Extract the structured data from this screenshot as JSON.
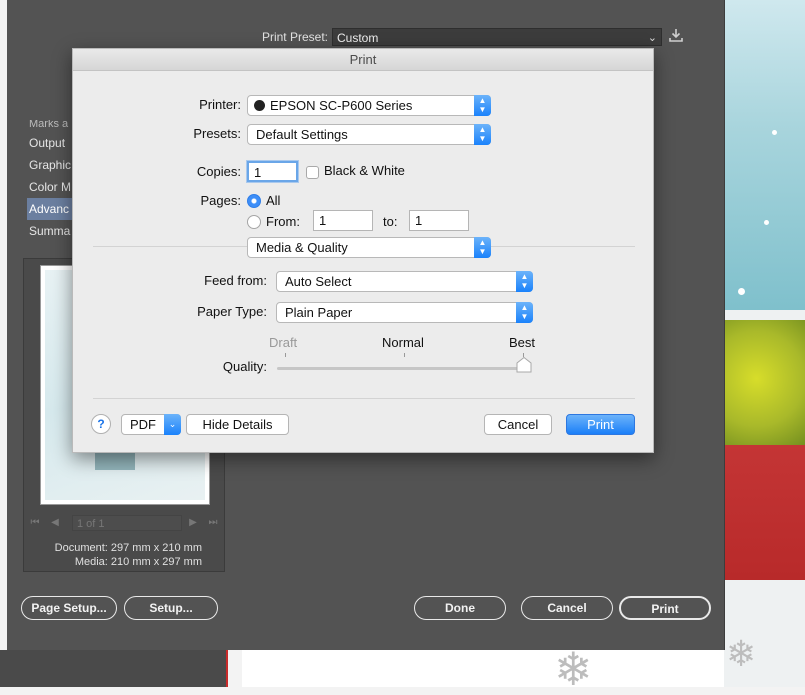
{
  "ai_dialog": {
    "print_preset_label": "Print Preset:",
    "print_preset_value": "Custom",
    "save_preset_icon": "download-icon",
    "categories": [
      {
        "label": "Marks a",
        "state": "partial"
      },
      {
        "label": "Output",
        "state": "normal"
      },
      {
        "label": "Graphic",
        "state": "normal"
      },
      {
        "label": "Color M",
        "state": "normal"
      },
      {
        "label": "Advanc",
        "state": "active"
      },
      {
        "label": "Summa",
        "state": "normal"
      }
    ],
    "page_nav_value": "1 of 1",
    "document_info": "Document: 297 mm x 210 mm",
    "media_info": "Media: 210 mm x 297 mm",
    "buttons": {
      "page_setup": "Page Setup...",
      "setup": "Setup...",
      "done": "Done",
      "cancel": "Cancel",
      "print": "Print"
    }
  },
  "print_sheet": {
    "title": "Print",
    "printer_label": "Printer:",
    "printer_value": "EPSON SC-P600 Series",
    "presets_label": "Presets:",
    "presets_value": "Default Settings",
    "copies_label": "Copies:",
    "copies_value": "1",
    "black_white_label": "Black & White",
    "black_white_checked": false,
    "pages_label": "Pages:",
    "pages_all_label": "All",
    "pages_from_label": "From:",
    "pages_from_value": "1",
    "pages_to_label": "to:",
    "pages_to_value": "1",
    "pages_selected": "All",
    "section_popup": "Media & Quality",
    "feed_from_label": "Feed from:",
    "feed_from_value": "Auto Select",
    "paper_type_label": "Paper Type:",
    "paper_type_value": "Plain Paper",
    "quality_label": "Quality:",
    "quality_draft": "Draft",
    "quality_normal": "Normal",
    "quality_best": "Best",
    "quality_level": "Best",
    "help_label": "?",
    "pdf_label": "PDF",
    "hide_details_label": "Hide Details",
    "cancel_label": "Cancel",
    "print_label": "Print",
    "accent_color": "#1b7ff8"
  }
}
